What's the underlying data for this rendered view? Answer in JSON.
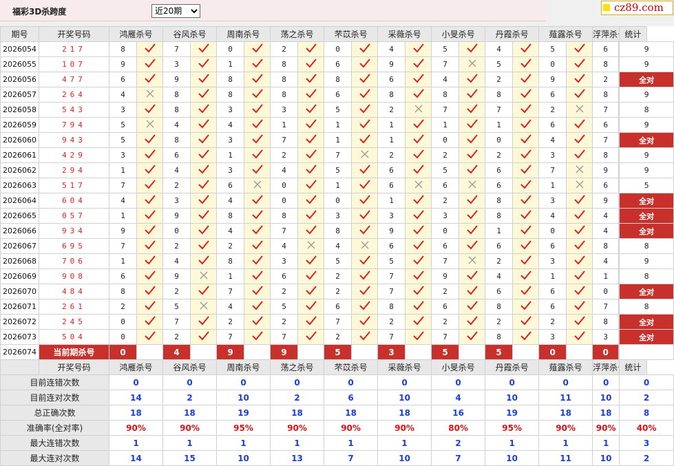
{
  "page": {
    "title": "福彩3D杀跨度",
    "period_select": "近20期",
    "logo": "cz89.com"
  },
  "table": {
    "header": [
      "期号",
      "开奖号码",
      "鸿雁杀号",
      "谷风杀号",
      "周南杀号",
      "荡之杀号",
      "芣苡杀号",
      "采薇杀号",
      "小旻杀号",
      "丹霞杀号",
      "薤露杀号",
      "浮萍杀号",
      "统计"
    ],
    "rows": [
      {
        "period": "2026054",
        "win": "217",
        "kills": [
          8,
          7,
          0,
          2,
          0,
          4,
          5,
          4,
          5,
          6
        ],
        "res": "1111111111",
        "total": "9"
      },
      {
        "period": "2026055",
        "win": "107",
        "kills": [
          9,
          3,
          1,
          8,
          6,
          9,
          7,
          5,
          0,
          8
        ],
        "res": "1111110111",
        "total": "9"
      },
      {
        "period": "2026056",
        "win": "477",
        "kills": [
          6,
          9,
          8,
          8,
          8,
          6,
          4,
          2,
          9,
          2
        ],
        "res": "1111111111",
        "total": "全对"
      },
      {
        "period": "2026057",
        "win": "264",
        "kills": [
          4,
          8,
          8,
          8,
          6,
          8,
          8,
          8,
          6,
          8
        ],
        "res": "0111111111",
        "total": "9"
      },
      {
        "period": "2026058",
        "win": "543",
        "kills": [
          3,
          8,
          3,
          3,
          5,
          2,
          7,
          7,
          2,
          7
        ],
        "res": "1111101101",
        "total": "8"
      },
      {
        "period": "2026059",
        "win": "794",
        "kills": [
          5,
          4,
          4,
          1,
          1,
          1,
          1,
          1,
          6,
          6
        ],
        "res": "0111111111",
        "total": "9"
      },
      {
        "period": "2026060",
        "win": "943",
        "kills": [
          5,
          8,
          3,
          7,
          1,
          1,
          0,
          0,
          4,
          7
        ],
        "res": "1111111111",
        "total": "全对"
      },
      {
        "period": "2026061",
        "win": "429",
        "kills": [
          3,
          6,
          1,
          2,
          7,
          2,
          2,
          2,
          3,
          8
        ],
        "res": "1111011111",
        "total": "9"
      },
      {
        "period": "2026062",
        "win": "294",
        "kills": [
          1,
          4,
          3,
          4,
          5,
          6,
          5,
          6,
          7,
          9
        ],
        "res": "1111111101",
        "total": "9"
      },
      {
        "period": "2026063",
        "win": "517",
        "kills": [
          7,
          2,
          6,
          0,
          1,
          6,
          6,
          6,
          1,
          6
        ],
        "res": "1101100101",
        "total": "5"
      },
      {
        "period": "2026064",
        "win": "604",
        "kills": [
          4,
          3,
          4,
          0,
          0,
          1,
          2,
          8,
          3,
          9
        ],
        "res": "1111111111",
        "total": "全对"
      },
      {
        "period": "2026065",
        "win": "057",
        "kills": [
          1,
          9,
          8,
          8,
          3,
          3,
          3,
          8,
          4,
          4
        ],
        "res": "1111111111",
        "total": "全对"
      },
      {
        "period": "2026066",
        "win": "934",
        "kills": [
          9,
          0,
          4,
          7,
          8,
          9,
          0,
          1,
          0,
          4
        ],
        "res": "1111111111",
        "total": "全对"
      },
      {
        "period": "2026067",
        "win": "695",
        "kills": [
          7,
          2,
          2,
          4,
          4,
          6,
          6,
          6,
          6,
          8
        ],
        "res": "1110011111",
        "total": "8"
      },
      {
        "period": "2026068",
        "win": "706",
        "kills": [
          1,
          4,
          8,
          3,
          5,
          5,
          7,
          2,
          3,
          4
        ],
        "res": "1111110111",
        "total": "9"
      },
      {
        "period": "2026069",
        "win": "908",
        "kills": [
          6,
          9,
          1,
          6,
          2,
          7,
          9,
          4,
          1,
          1
        ],
        "res": "1011111111",
        "total": "8"
      },
      {
        "period": "2026070",
        "win": "484",
        "kills": [
          8,
          2,
          7,
          2,
          2,
          7,
          2,
          6,
          6,
          0
        ],
        "res": "1111111111",
        "total": "全对"
      },
      {
        "period": "2026071",
        "win": "261",
        "kills": [
          2,
          5,
          4,
          5,
          6,
          8,
          6,
          8,
          6,
          7
        ],
        "res": "1011111111",
        "total": "8"
      },
      {
        "period": "2026072",
        "win": "245",
        "kills": [
          0,
          7,
          2,
          2,
          7,
          2,
          2,
          2,
          2,
          8
        ],
        "res": "1111111111",
        "total": "全对"
      },
      {
        "period": "2026073",
        "win": "504",
        "kills": [
          0,
          2,
          7,
          7,
          2,
          7,
          7,
          8,
          3,
          3
        ],
        "res": "1111111111",
        "total": "全对"
      }
    ],
    "current": {
      "period": "2026074",
      "label": "当前期杀号",
      "kills": [
        "0",
        "4",
        "9",
        "9",
        "5",
        "3",
        "5",
        "5",
        "0",
        "0"
      ]
    }
  },
  "stats": {
    "header": [
      "",
      "开奖号码",
      "鸿雁杀号",
      "谷风杀号",
      "周南杀号",
      "荡之杀号",
      "芣苡杀号",
      "采薇杀号",
      "小旻杀号",
      "丹霞杀号",
      "薤露杀号",
      "浮萍杀号",
      "统计"
    ],
    "rows": [
      {
        "label": "目前连错次数",
        "values": [
          "0",
          "0",
          "0",
          "0",
          "0",
          "0",
          "0",
          "0",
          "0",
          "0",
          "0"
        ]
      },
      {
        "label": "目前连对次数",
        "values": [
          "14",
          "2",
          "10",
          "2",
          "6",
          "10",
          "4",
          "10",
          "11",
          "10",
          "2"
        ]
      },
      {
        "label": "总正确次数",
        "values": [
          "18",
          "18",
          "19",
          "18",
          "18",
          "18",
          "16",
          "19",
          "18",
          "18",
          "8"
        ]
      },
      {
        "label": "准确率(全对率)",
        "values": [
          "90%",
          "90%",
          "95%",
          "90%",
          "90%",
          "90%",
          "80%",
          "95%",
          "90%",
          "90%",
          "40%"
        ],
        "red": true
      },
      {
        "label": "最大连错次数",
        "values": [
          "1",
          "1",
          "1",
          "1",
          "1",
          "1",
          "2",
          "1",
          "1",
          "1",
          "3"
        ]
      },
      {
        "label": "最大连对次数",
        "values": [
          "14",
          "15",
          "10",
          "13",
          "7",
          "10",
          "7",
          "10",
          "11",
          "10",
          "2"
        ]
      }
    ]
  },
  "colors": {
    "accent": "#c8302c",
    "check": "#e02020",
    "cross": "#999999",
    "stat_blue": "#1c3ed8",
    "mark_bg": "#fdf8d8"
  }
}
